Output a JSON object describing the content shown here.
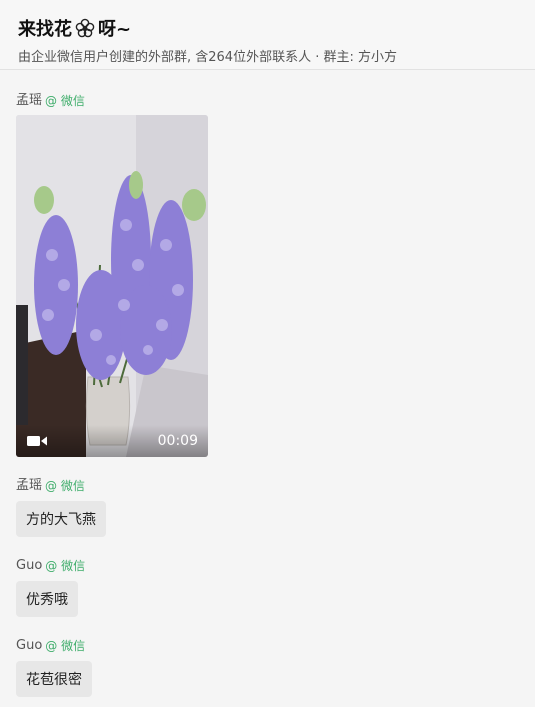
{
  "chat": {
    "title": "来找花",
    "title_suffix": "呀~",
    "subtitle": "由企业微信用户创建的外部群, 含264位外部联系人 · 群主: 方小方"
  },
  "messages": [
    {
      "sender": "孟瑶",
      "source": "@ 微信",
      "type": "video",
      "duration": "00:09"
    },
    {
      "sender": "孟瑶",
      "source": "@ 微信",
      "type": "text",
      "text": "方的大飞燕"
    },
    {
      "sender": "Guo",
      "source": "@ 微信",
      "type": "text",
      "text": "优秀哦"
    },
    {
      "sender": "Guo",
      "source": "@ 微信",
      "type": "text",
      "text": "花苞很密"
    }
  ],
  "icons": {
    "title_emoji": "flower-icon",
    "video_badge": "video-camera-icon"
  },
  "colors": {
    "source_green": "#3fad6b",
    "bubble_bg": "#e7e7e7",
    "flower_purple": "#8d7fd6"
  }
}
